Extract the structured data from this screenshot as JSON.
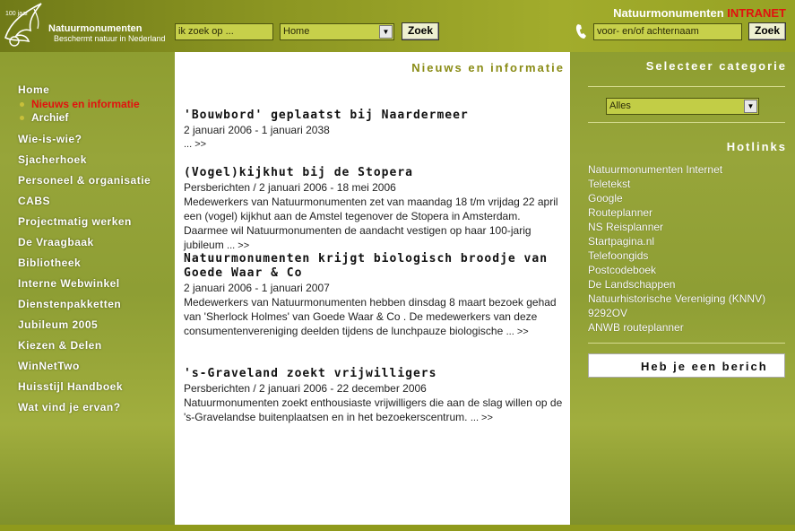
{
  "header": {
    "logo": {
      "years": "100 jaar",
      "name": "Natuurmonumenten",
      "tagline": "Beschermt natuur in Nederland"
    },
    "search_placeholder": "ik zoek op ...",
    "section_select": "Home",
    "search_button": "Zoek",
    "intranet": {
      "prefix": "Natuurmonumenten",
      "suffix": "INTRANET"
    },
    "name_placeholder": "voor- en/of achternaam",
    "name_search_button": "Zoek"
  },
  "nav": {
    "items": [
      "Home",
      "Wie-is-wie?",
      "Sjacherhoek",
      "Personeel & organisatie",
      "CABS",
      "Projectmatig werken",
      "De Vraagbaak",
      "Bibliotheek",
      "Interne Webwinkel",
      "Dienstenpakketten",
      "Jubileum 2005",
      "Kiezen & Delen",
      "WinNetTwo",
      "Huisstijl Handboek",
      "Wat vind je ervan?"
    ],
    "subitems": [
      {
        "label": "Nieuws en informatie",
        "active": true
      },
      {
        "label": "Archief",
        "active": false
      }
    ]
  },
  "main": {
    "title": "Nieuws en informatie",
    "news": [
      {
        "title": "'Bouwbord' geplaatst bij Naardermeer",
        "meta": "2 januari 2006 - 1 januari 2038",
        "description": "",
        "more": "... >>"
      },
      {
        "title": "(Vogel)kijkhut bij de Stopera",
        "meta": "Persberichten / 2 januari 2006 - 18 mei 2006",
        "description": "Medewerkers van Natuurmonumenten zet van maandag 18 t/m vrijdag 22 april een (vogel) kijkhut aan de Amstel tegenover de Stopera in Amsterdam. Daarmee wil Natuurmonumenten de aandacht vestigen op haar 100-jarig jubileum",
        "more": "... >>"
      },
      {
        "title": "Natuurmonumenten krijgt biologisch broodje van Goede Waar & Co",
        "meta": "2 januari 2006 - 1 januari 2007",
        "description": "Medewerkers van Natuurmonumenten hebben dinsdag 8 maart bezoek gehad van 'Sherlock Holmes' van Goede Waar & Co . De medewerkers van deze consumentenvereniging deelden tijdens de lunchpauze biologische",
        "more": "... >>"
      },
      {
        "title": "'s-Graveland zoekt vrijwilligers",
        "meta": "Persberichten / 2 januari 2006 - 22 december 2006",
        "description": "Natuurmonumenten zoekt enthousiaste vrijwilligers die aan de slag willen op de 's-Gravelandse buitenplaatsen en in het bezoekerscentrum.",
        "more": "... >>"
      }
    ]
  },
  "right": {
    "category_heading": "Selecteer categorie",
    "category_select": "Alles",
    "hotlinks_heading": "Hotlinks",
    "hotlinks": [
      "Natuurmonumenten Internet",
      "Teletekst",
      "Google",
      "Routeplanner",
      "NS Reisplanner",
      "Startpagina.nl",
      "Telefoongids",
      "Postcodeboek",
      "De Landschappen",
      "Natuurhistorische Vereniging (KNNV)",
      "9292OV",
      "ANWB routeplanner"
    ],
    "message": "Heb je een berich"
  },
  "colors": {
    "accent_red": "#e1120f",
    "header_green": "#8c9622",
    "field_green": "#c7d04a",
    "title_olive": "#8a8c16"
  },
  "icons": [
    "bird-logo-icon",
    "phone-icon",
    "chevron-down-icon",
    "bullet-icon"
  ]
}
